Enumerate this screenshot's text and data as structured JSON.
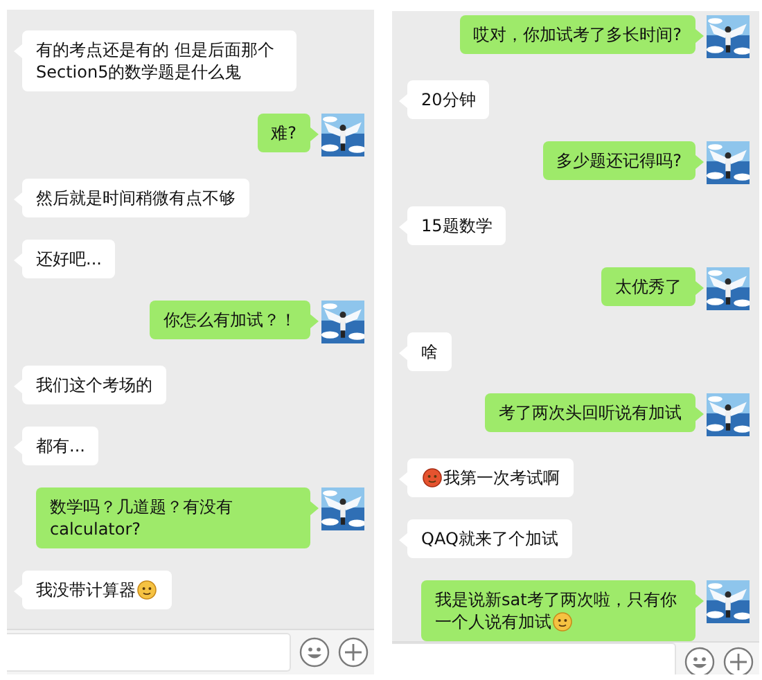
{
  "panels": [
    {
      "messages": [
        {
          "kind": "incoming",
          "text": "有的考点还是有的 但是后面那个Section5的数学题是什么鬼"
        },
        {
          "kind": "outgoing",
          "text": "难?"
        },
        {
          "kind": "incoming",
          "text": "然后就是时间稍微有点不够"
        },
        {
          "kind": "incoming",
          "text": "还好吧..."
        },
        {
          "kind": "outgoing",
          "text": "你怎么有加试？！"
        },
        {
          "kind": "incoming",
          "text": "我们这个考场的"
        },
        {
          "kind": "incoming",
          "text": "都有..."
        },
        {
          "kind": "outgoing",
          "text": "数学吗？几道题？有没有calculator?"
        },
        {
          "kind": "incoming",
          "text": "我没带计算器",
          "emoji_after": true
        }
      ]
    },
    {
      "messages": [
        {
          "kind": "outgoing",
          "text": "哎对，你加试考了多长时间?"
        },
        {
          "kind": "incoming",
          "text": "20分钟"
        },
        {
          "kind": "outgoing",
          "text": "多少题还记得吗?"
        },
        {
          "kind": "incoming",
          "text": "15题数学"
        },
        {
          "kind": "outgoing",
          "text": "太优秀了"
        },
        {
          "kind": "incoming",
          "text": "啥"
        },
        {
          "kind": "outgoing",
          "text": "考了两次头回听说有加试"
        },
        {
          "kind": "incoming",
          "text": "我第一次考试啊",
          "emoji_before": true
        },
        {
          "kind": "incoming",
          "text": "QAQ就来了个加试"
        },
        {
          "kind": "outgoing",
          "text": "我是说新sat考了两次啦，只有你一个人说有加试",
          "emoji_after": true
        }
      ]
    }
  ]
}
